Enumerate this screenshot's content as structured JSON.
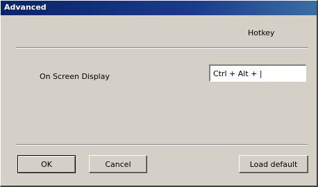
{
  "window": {
    "title": "Advanced"
  },
  "header": {
    "column_label": "Hotkey"
  },
  "settings": [
    {
      "label": "On Screen Display",
      "value": "Ctrl + Alt + |"
    }
  ],
  "buttons": {
    "ok": "OK",
    "cancel": "Cancel",
    "load_default": "Load default"
  }
}
